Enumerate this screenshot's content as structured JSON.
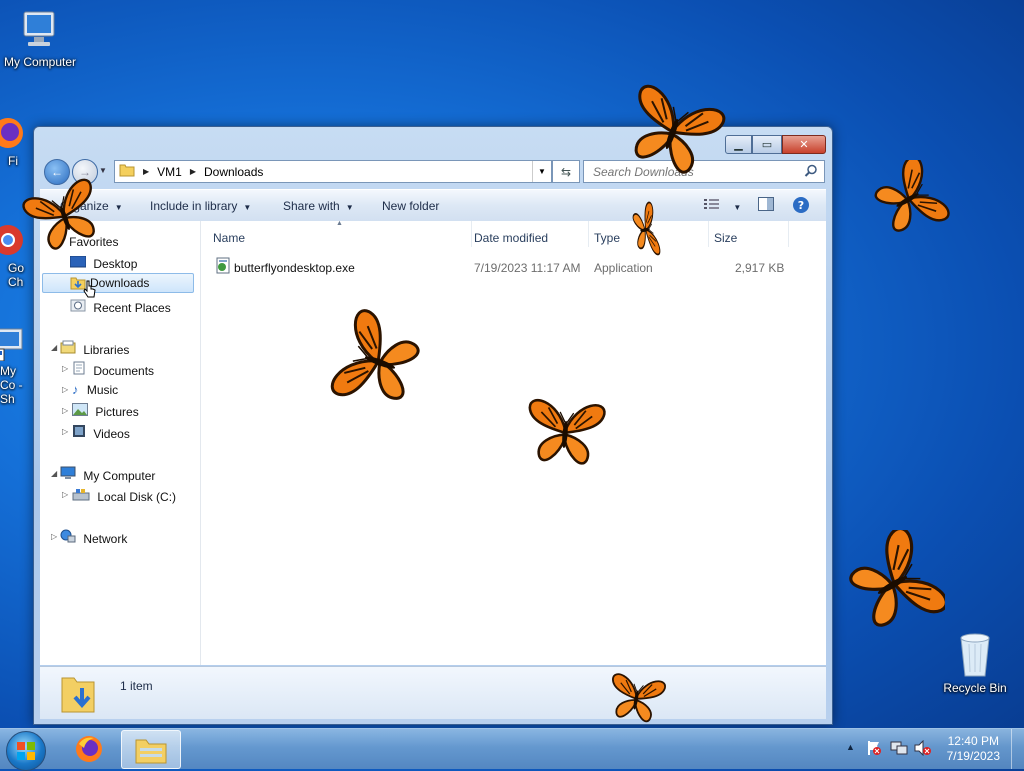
{
  "desktop": {
    "icons": [
      {
        "label": "My Computer"
      },
      {
        "label": "Fi"
      },
      {
        "label": "Go Ch"
      },
      {
        "label": "My Co - Sh"
      },
      {
        "label": "Recycle Bin"
      }
    ]
  },
  "window": {
    "breadcrumb": [
      "VM1",
      "Downloads"
    ],
    "search_placeholder": "Search Downloads",
    "toolbar": {
      "organize": "Organize",
      "include_in_library": "Include in library",
      "share_with": "Share with",
      "new_folder": "New folder"
    },
    "navpane": {
      "favorites": "Favorites",
      "favorites_items": [
        "Desktop",
        "Downloads",
        "Recent Places"
      ],
      "libraries": "Libraries",
      "libraries_items": [
        "Documents",
        "Music",
        "Pictures",
        "Videos"
      ],
      "computer": "My Computer",
      "computer_items": [
        "Local Disk (C:)"
      ],
      "network": "Network"
    },
    "columns": [
      "Name",
      "Date modified",
      "Type",
      "Size"
    ],
    "files": [
      {
        "name": "butterflyondesktop.exe",
        "date_modified": "7/19/2023 11:17 AM",
        "type": "Application",
        "size": "2,917 KB"
      }
    ],
    "status": "1 item"
  },
  "taskbar": {
    "clock_time": "12:40 PM",
    "clock_date": "7/19/2023"
  },
  "colors": {
    "butterfly": "#f07a10",
    "accent": "#1570d8"
  }
}
